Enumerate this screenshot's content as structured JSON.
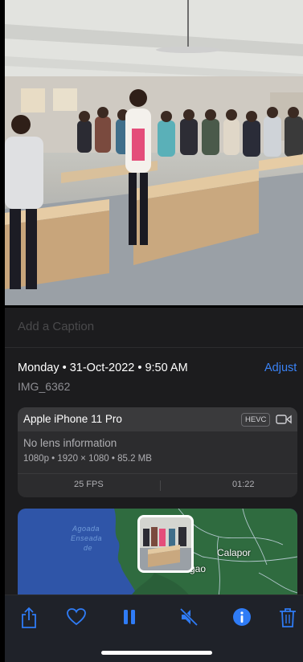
{
  "caption": {
    "placeholder": "Add a Caption"
  },
  "info": {
    "date": "Monday • 31-Oct-2022 • 9:50 AM",
    "adjust_label": "Adjust",
    "filename": "IMG_6362"
  },
  "device_card": {
    "device": "Apple iPhone 11 Pro",
    "format_badge": "HEVC",
    "lens": "No lens information",
    "specs": "1080p • 1920 × 1080 • 85.2 MB",
    "fps": "25 FPS",
    "duration": "01:22"
  },
  "map": {
    "labels": [
      "Agoada",
      "Enseada",
      "de"
    ],
    "places": [
      "Calapor",
      "gao"
    ]
  },
  "toolbar": {
    "icons": [
      "share-icon",
      "heart-icon",
      "pause-icon",
      "mute-icon",
      "info-icon",
      "trash-icon"
    ]
  },
  "colors": {
    "accent": "#3a83f7",
    "background": "#1c1c1e",
    "card": "#2c2c2e",
    "map_water": "#2f55a8"
  }
}
